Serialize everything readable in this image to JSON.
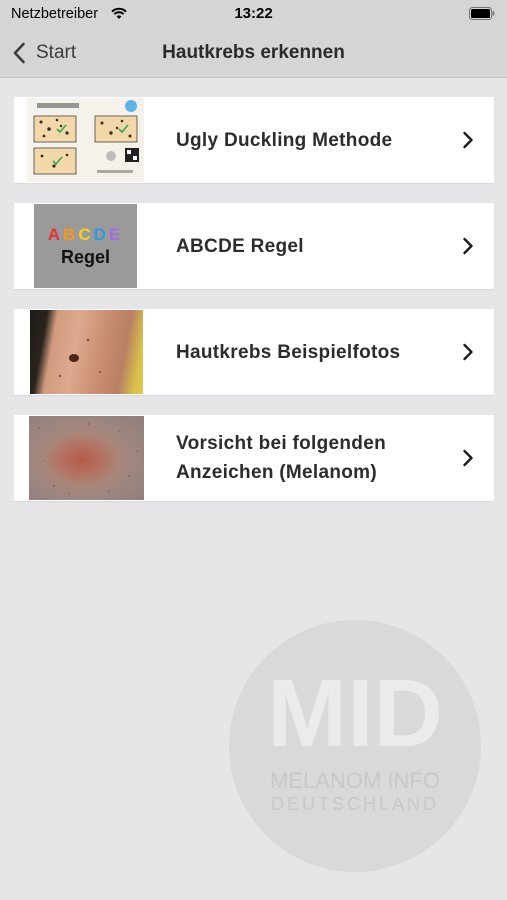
{
  "status_bar": {
    "carrier": "Netzbetreiber",
    "time": "13:22"
  },
  "nav": {
    "back_label": "Start",
    "title": "Hautkrebs erkennen"
  },
  "items": [
    {
      "label": "Ugly Duckling Methode",
      "thumb": "ugly-duckling-diagram"
    },
    {
      "label": "ABCDE Regel",
      "thumb": "abcde-rule-graphic"
    },
    {
      "label": "Hautkrebs Beispielfotos",
      "thumb": "skin-photo"
    },
    {
      "label": "Vorsicht bei folgenden Anzeichen (Melanom)",
      "thumb": "melanoma-closeup"
    }
  ],
  "abcde_thumb": {
    "letters": [
      "A",
      "B",
      "C",
      "D",
      "E"
    ],
    "word": "Regel"
  },
  "watermark": {
    "logo": "MID",
    "line1": "MELANOM INFO",
    "line2": "DEUTSCHLAND"
  },
  "colors": {
    "background": "#e6e5e7",
    "bar": "#d5d4d6",
    "card": "#ffffff",
    "text": "#2c2c2e"
  }
}
